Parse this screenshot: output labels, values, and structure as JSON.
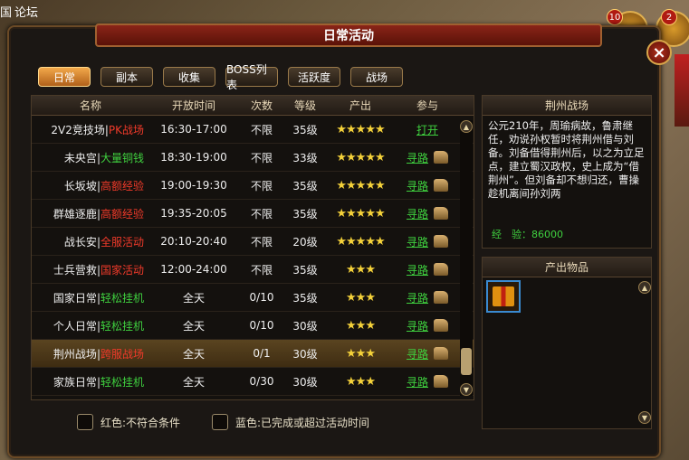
{
  "topbar": {
    "left": "国",
    "label": "论坛"
  },
  "badges": [
    "10",
    "2"
  ],
  "title": "日常活动",
  "close_label": "×",
  "tabs": [
    "日常",
    "副本",
    "收集",
    "BOSS列表",
    "活跃度",
    "战场"
  ],
  "columns": [
    "名称",
    "开放时间",
    "次数",
    "等级",
    "产出",
    "参与"
  ],
  "rows": [
    {
      "name": "2V2竞技场",
      "tag": "PK战场",
      "tag_color": "red",
      "time": "16:30-17:00",
      "times": "不限",
      "level": "35级",
      "stars": "★★★★★",
      "action": "打开",
      "boot": false
    },
    {
      "name": "未央宫",
      "tag": "大量铜钱",
      "tag_color": "green",
      "time": "18:30-19:00",
      "times": "不限",
      "level": "33级",
      "stars": "★★★★★",
      "action": "寻路",
      "boot": true
    },
    {
      "name": "长坂坡",
      "tag": "高额经验",
      "tag_color": "red",
      "time": "19:00-19:30",
      "times": "不限",
      "level": "35级",
      "stars": "★★★★★",
      "action": "寻路",
      "boot": true
    },
    {
      "name": "群雄逐鹿",
      "tag": "高额经验",
      "tag_color": "red",
      "time": "19:35-20:05",
      "times": "不限",
      "level": "35级",
      "stars": "★★★★★",
      "action": "寻路",
      "boot": true
    },
    {
      "name": "战长安",
      "tag": "全服活动",
      "tag_color": "red",
      "time": "20:10-20:40",
      "times": "不限",
      "level": "20级",
      "stars": "★★★★★",
      "action": "寻路",
      "boot": true
    },
    {
      "name": "士兵营救",
      "tag": "国家活动",
      "tag_color": "red",
      "time": "12:00-24:00",
      "times": "不限",
      "level": "35级",
      "stars": "★★★",
      "action": "寻路",
      "boot": true
    },
    {
      "name": "国家日常",
      "tag": "轻松挂机",
      "tag_color": "green",
      "time": "全天",
      "times": "0/10",
      "level": "35级",
      "stars": "★★★",
      "action": "寻路",
      "boot": true
    },
    {
      "name": "个人日常",
      "tag": "轻松挂机",
      "tag_color": "green",
      "time": "全天",
      "times": "0/10",
      "level": "30级",
      "stars": "★★★",
      "action": "寻路",
      "boot": true
    },
    {
      "name": "荆州战场",
      "tag": "跨服战场",
      "tag_color": "red",
      "time": "全天",
      "times": "0/1",
      "level": "30级",
      "stars": "★★★",
      "action": "寻路",
      "boot": true,
      "selected": true
    },
    {
      "name": "家族日常",
      "tag": "轻松挂机",
      "tag_color": "green",
      "time": "全天",
      "times": "0/30",
      "level": "30级",
      "stars": "★★★",
      "action": "寻路",
      "boot": true
    }
  ],
  "info": {
    "title": "荆州战场",
    "desc": "公元210年，周瑜病故，鲁肃继任，劝说孙权暂时将荆州借与刘备。刘备借得荆州后，以之为立足点，建立蜀汉政权，史上成为“借荆州”。但刘备却不想归还，曹操趁机离间孙刘两",
    "exp": "经　验：86000"
  },
  "product": {
    "title": "产出物品",
    "item": "gift-box"
  },
  "legend": [
    "红色:不符合条件",
    "蓝色:已完成或超过活动时间"
  ],
  "colors": {
    "green": "#3fd03f",
    "red": "#f03a2a",
    "star": "#f5d23a"
  }
}
